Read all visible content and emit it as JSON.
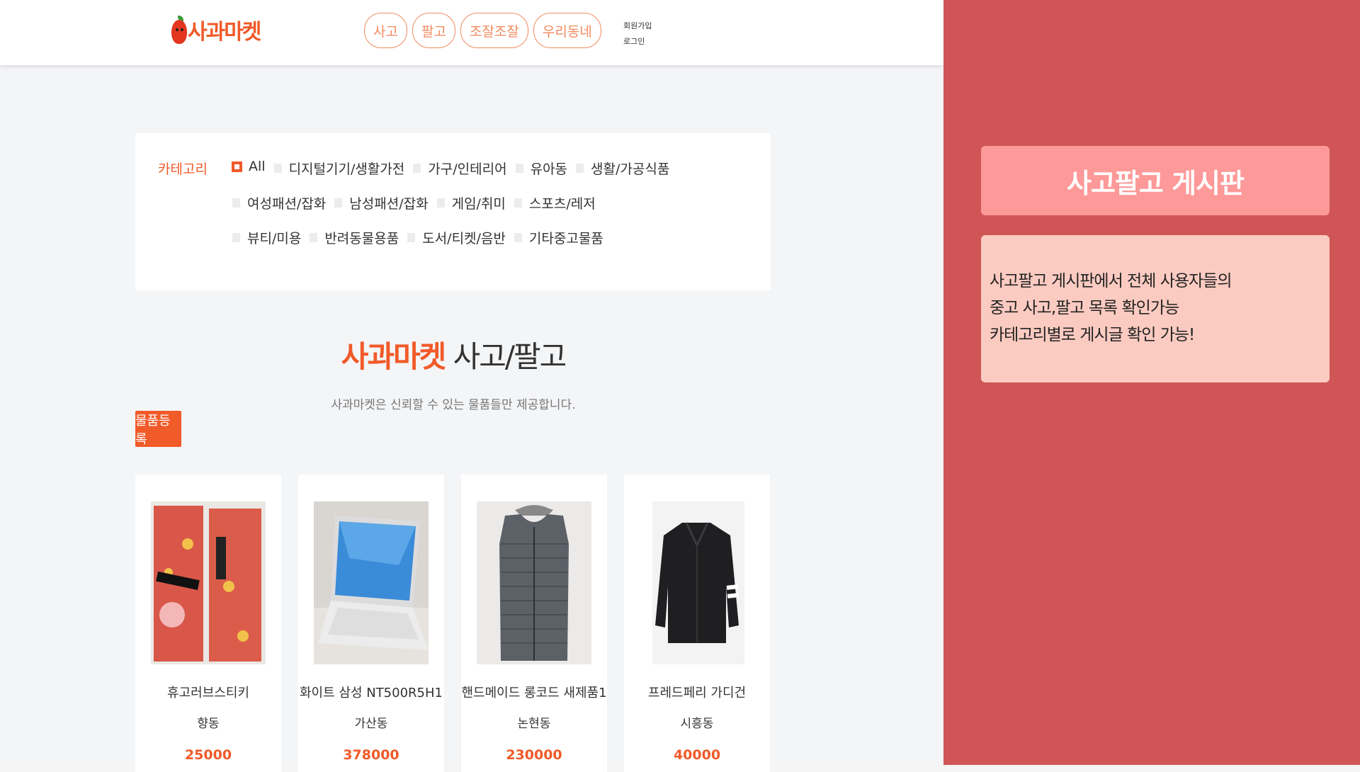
{
  "header": {
    "logo_text": "사과마켓",
    "nav": [
      "사고",
      "팔고",
      "조잘조잘",
      "우리동네"
    ],
    "signup": "회원가입",
    "login": "로그인"
  },
  "category": {
    "title": "카테고리",
    "rows": [
      [
        {
          "label": "All",
          "checked": true
        },
        {
          "label": "디지털기기/생활가전"
        },
        {
          "label": "가구/인테리어"
        },
        {
          "label": "유아동"
        },
        {
          "label": "생활/가공식품"
        }
      ],
      [
        {
          "label": "여성패션/잡화"
        },
        {
          "label": "남성패션/잡화"
        },
        {
          "label": "게임/취미"
        },
        {
          "label": "스포츠/레저"
        }
      ],
      [
        {
          "label": "뷰티/미용"
        },
        {
          "label": "반려동물용품"
        },
        {
          "label": "도서/티켓/음반"
        },
        {
          "label": "기타중고물품"
        }
      ]
    ]
  },
  "main": {
    "heading_brand": "사과마켓",
    "heading_rest": " 사고/팔고",
    "subheading": "사과마켓은 신뢰할 수 있는 물품들만 제공합니다.",
    "register_label": "물품등록"
  },
  "products": [
    {
      "name": "휴고러브스티키",
      "location": "향동",
      "price": "25000",
      "image": "red-patterned-socks"
    },
    {
      "name": "화이트 삼성 NT500R5H1",
      "location": "가산동",
      "price": "378000",
      "image": "white-laptop"
    },
    {
      "name": "핸드메이드 롱코드 새제품1",
      "location": "논현동",
      "price": "230000",
      "image": "grey-padded-vest"
    },
    {
      "name": "프레드페리 가디건",
      "location": "시흥동",
      "price": "40000",
      "image": "black-cardigan"
    }
  ],
  "sidebar": {
    "title": "사고팔고 게시판",
    "lines": [
      "사고팔고 게시판에서 전체 사용자들의",
      "중고 사고,팔고 목록 확인가능",
      "카테고리별로 게시글 확인 가능!"
    ]
  },
  "colors": {
    "accent": "#f15a29",
    "side_bg": "#d05556",
    "side_title_bg": "#fe9999",
    "side_desc_bg": "#fbcbc1"
  }
}
